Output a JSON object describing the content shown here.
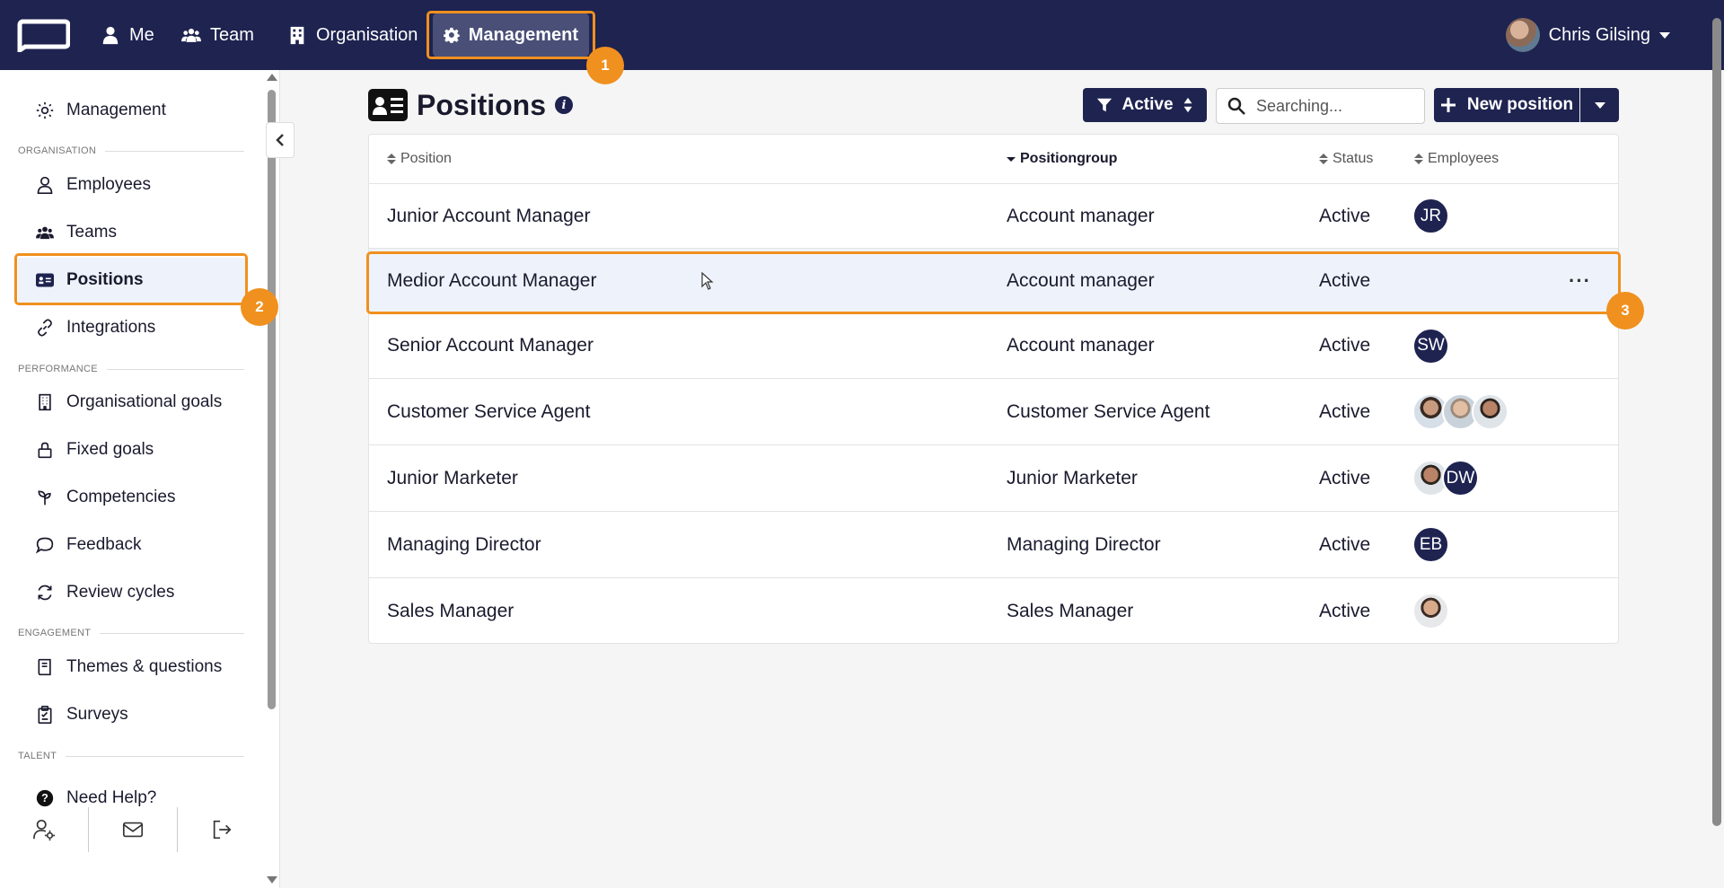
{
  "topnav": {
    "items": [
      {
        "label": "Me",
        "icon": "user-icon"
      },
      {
        "label": "Team",
        "icon": "users-icon"
      },
      {
        "label": "Organisation",
        "icon": "building-icon"
      },
      {
        "label": "Management",
        "icon": "gear-icon",
        "active": true
      }
    ],
    "user_name": "Chris Gilsing"
  },
  "sidebar": {
    "management_label": "Management",
    "sections": {
      "organisation": "ORGANISATION",
      "performance": "PERFORMANCE",
      "engagement": "ENGAGEMENT",
      "talent": "TALENT"
    },
    "items": {
      "employees": "Employees",
      "teams": "Teams",
      "positions": "Positions",
      "integrations": "Integrations",
      "org_goals": "Organisational goals",
      "fixed_goals": "Fixed goals",
      "competencies": "Competencies",
      "feedback": "Feedback",
      "review_cycles": "Review cycles",
      "themes": "Themes & questions",
      "surveys": "Surveys",
      "help": "Need Help?"
    }
  },
  "main": {
    "title": "Positions",
    "filter_label": "Active",
    "search_placeholder": "Searching...",
    "new_button": "New position"
  },
  "table": {
    "headers": {
      "position": "Position",
      "positiongroup": "Positiongroup",
      "status": "Status",
      "employees": "Employees"
    },
    "rows": [
      {
        "position": "Junior Account Manager",
        "group": "Account manager",
        "status": "Active",
        "employees": [
          "JR"
        ]
      },
      {
        "position": "Medior Account Manager",
        "group": "Account manager",
        "status": "Active",
        "employees": []
      },
      {
        "position": "Senior Account Manager",
        "group": "Account manager",
        "status": "Active",
        "employees": [
          "SW"
        ]
      },
      {
        "position": "Customer Service Agent",
        "group": "Customer Service Agent",
        "status": "Active",
        "employees": [
          "photo",
          "photo",
          "photo"
        ]
      },
      {
        "position": "Junior Marketer",
        "group": "Junior Marketer",
        "status": "Active",
        "employees": [
          "photo",
          "DW"
        ]
      },
      {
        "position": "Managing Director",
        "group": "Managing Director",
        "status": "Active",
        "employees": [
          "EB"
        ]
      },
      {
        "position": "Sales Manager",
        "group": "Sales Manager",
        "status": "Active",
        "employees": [
          "photo"
        ]
      }
    ]
  },
  "annotations": [
    "1",
    "2",
    "3"
  ],
  "colors": {
    "nav_bg": "#1e2350",
    "accent_orange": "#f0901e",
    "selected_bg": "#eef3fb"
  }
}
